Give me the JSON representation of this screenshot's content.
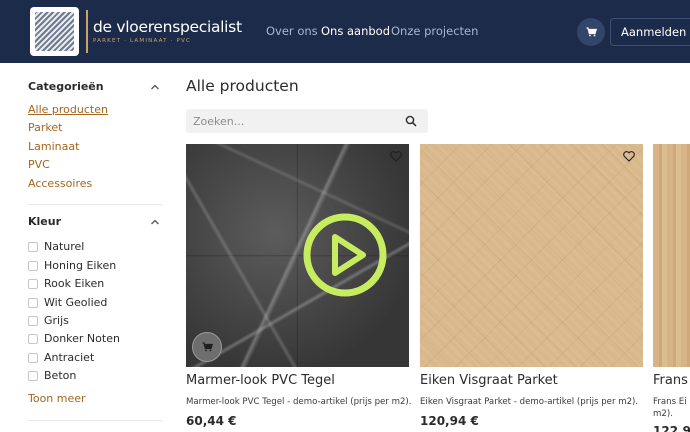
{
  "header": {
    "brand_name": "de vloerenspecialist",
    "brand_tagline": "PARKET · LAMINAAT · PVC",
    "nav": [
      {
        "label": "Over ons",
        "active": false
      },
      {
        "label": "Ons aanbod",
        "active": true
      },
      {
        "label": "Onze projecten",
        "active": false
      }
    ],
    "cart_icon": "cart-icon",
    "login_label": "Aanmelden"
  },
  "sidebar": {
    "categories_heading": "Categorieën",
    "categories": [
      {
        "label": "Alle producten",
        "active": true
      },
      {
        "label": "Parket",
        "active": false
      },
      {
        "label": "Laminaat",
        "active": false
      },
      {
        "label": "PVC",
        "active": false
      },
      {
        "label": "Accessoires",
        "active": false
      }
    ],
    "color_heading": "Kleur",
    "colors": [
      "Naturel",
      "Honing Eiken",
      "Rook Eiken",
      "Wit Geolied",
      "Grijs",
      "Donker Noten",
      "Antraciet",
      "Beton"
    ],
    "show_more": "Toon meer"
  },
  "main": {
    "title": "Alle producten",
    "search_placeholder": "Zoeken...",
    "products": [
      {
        "title": "Marmer-look PVC Tegel",
        "description": "Marmer-look PVC Tegel - demo-artikel (prijs per m2).",
        "price": "60,44 €"
      },
      {
        "title": "Eiken Visgraat Parket",
        "description": "Eiken Visgraat Parket - demo-artikel (prijs per m2).",
        "price": "120,94 €"
      },
      {
        "title": "Frans",
        "description": "Frans Ei",
        "description2": "m2).",
        "price": "122,9"
      }
    ]
  },
  "colors": {
    "header_bg": "#1d2b4b",
    "accent_gold": "#c9a46a",
    "link_brown": "#a4651f",
    "play_green": "#c8ec60"
  }
}
